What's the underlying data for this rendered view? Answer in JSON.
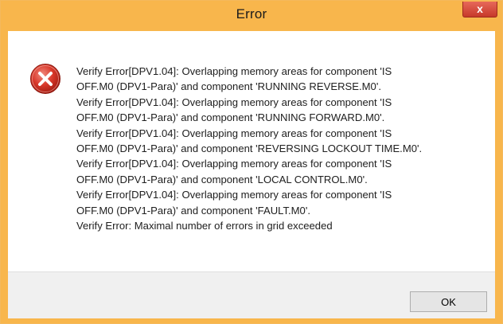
{
  "window": {
    "title": "Error",
    "close_glyph": "x",
    "accent_color": "#f8b64c"
  },
  "dialog": {
    "icon": "error-icon",
    "message_lines": [
      "Verify Error[DPV1.04]: Overlapping memory areas for component 'IS",
      "OFF.M0 (DPV1-Para)' and component 'RUNNING REVERSE.M0'.",
      "Verify Error[DPV1.04]: Overlapping memory areas for component 'IS",
      "OFF.M0 (DPV1-Para)' and component 'RUNNING FORWARD.M0'.",
      "Verify Error[DPV1.04]: Overlapping memory areas for component 'IS",
      "OFF.M0 (DPV1-Para)' and component 'REVERSING LOCKOUT TIME.M0'.",
      "Verify Error[DPV1.04]: Overlapping memory areas for component 'IS",
      "OFF.M0 (DPV1-Para)' and component 'LOCAL CONTROL.M0'.",
      "Verify Error[DPV1.04]: Overlapping memory areas for component 'IS",
      "OFF.M0 (DPV1-Para)' and component 'FAULT.M0'.",
      "Verify Error: Maximal number of errors in grid exceeded"
    ],
    "ok_label": "OK"
  }
}
